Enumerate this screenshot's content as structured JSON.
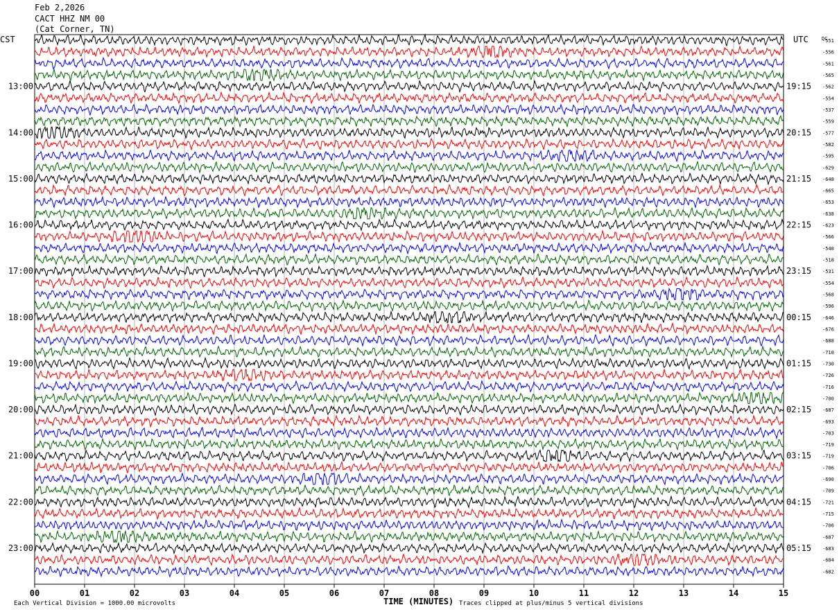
{
  "header": {
    "date": "Feb 2,2026",
    "station": "CACT HHZ NM 00",
    "location": "(Cat Corner, TN)"
  },
  "corner_left": "CST",
  "corner_right": "UTC",
  "dc_label": "DC",
  "footer": {
    "scale": "Each Vertical Division = 1000.00 microvolts",
    "xtitle": "TIME (MINUTES)",
    "clip": "Traces clipped at plus/minus 5 vertical divisions"
  },
  "colors": {
    "black": "#000000",
    "red": "#ff0000",
    "blue": "#0000ff",
    "green": "#006400",
    "grid": "#808080"
  },
  "chart_data": {
    "type": "line",
    "title": "CACT HHZ NM 00",
    "xlabel": "TIME (MINUTES)",
    "xlim": [
      0,
      15
    ],
    "x_ticks": [
      "00",
      "01",
      "02",
      "03",
      "04",
      "05",
      "06",
      "07",
      "08",
      "09",
      "10",
      "11",
      "12",
      "13",
      "14",
      "15"
    ],
    "left_hour_labels": [
      "13:00",
      "14:00",
      "15:00",
      "16:00",
      "17:00",
      "18:00",
      "19:00",
      "20:00",
      "21:00",
      "22:00",
      "23:00"
    ],
    "right_hour_labels": [
      "19:15",
      "20:15",
      "21:15",
      "22:15",
      "23:15",
      "00:15",
      "01:15",
      "02:15",
      "03:15",
      "04:15",
      "05:15"
    ],
    "trace_colors": [
      "black",
      "red",
      "blue",
      "green"
    ],
    "dc_offsets": [
      551,
      556,
      561,
      565,
      562,
      554,
      537,
      559,
      577,
      582,
      595,
      629,
      648,
      665,
      653,
      638,
      623,
      566,
      540,
      518,
      531,
      554,
      568,
      596,
      646,
      676,
      688,
      710,
      730,
      726,
      716,
      700,
      687,
      693,
      703,
      719,
      719,
      706,
      690,
      709,
      721,
      715,
      706,
      687,
      683,
      684,
      682
    ]
  }
}
